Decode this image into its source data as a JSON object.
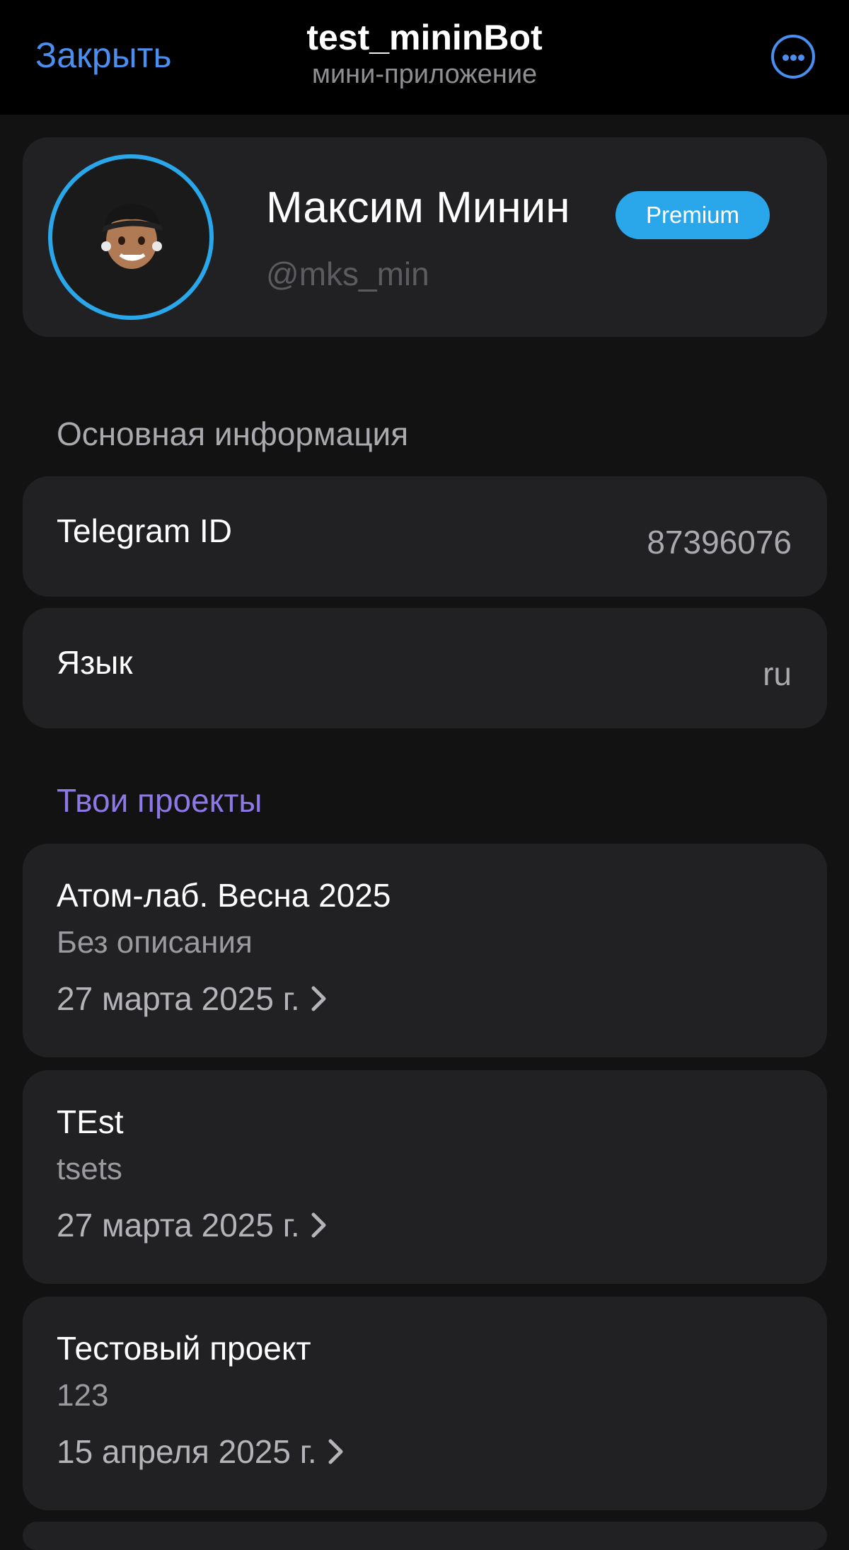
{
  "header": {
    "close_label": "Закрыть",
    "title": "test_mininBot",
    "subtitle": "мини-приложение",
    "more_icon": "ellipsis-circle-icon"
  },
  "profile": {
    "name": "Максим Минин",
    "badge": "Premium",
    "username": "@mks_min",
    "avatar": "memoji-avatar"
  },
  "basic_info": {
    "section_title": "Основная информация",
    "rows": [
      {
        "label": "Telegram ID",
        "value": "87396076"
      },
      {
        "label": "Язык",
        "value": "ru"
      }
    ]
  },
  "projects": {
    "section_title": "Твои проекты",
    "items": [
      {
        "title": "Атом-лаб. Весна 2025",
        "description": "Без описания",
        "date": "27 марта 2025 г."
      },
      {
        "title": "TEst",
        "description": "tsets",
        "date": "27 марта 2025 г."
      },
      {
        "title": "Тестовый проект",
        "description": "123",
        "date": "15 апреля 2025 г."
      }
    ]
  },
  "colors": {
    "accent_blue": "#4a8ff0",
    "premium": "#2aa7ea",
    "section_purple": "#8e78e6",
    "card_bg": "#212123",
    "page_bg": "#121213"
  }
}
